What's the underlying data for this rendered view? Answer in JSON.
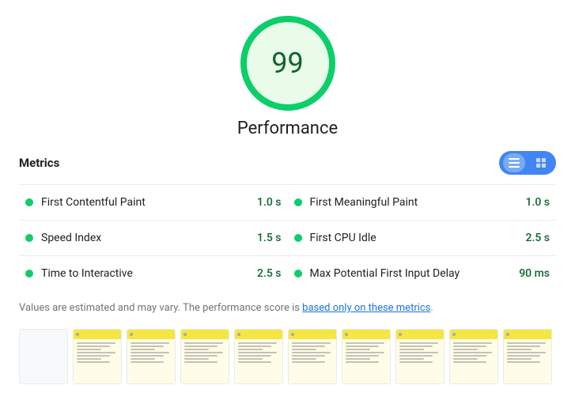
{
  "score": {
    "value": "99",
    "label": "Performance"
  },
  "metrics": {
    "title": "Metrics",
    "toggle": {
      "list_label": "List view",
      "grid_label": "Grid view"
    },
    "items": [
      {
        "name": "First Contentful Paint",
        "value": "1.0 s",
        "color": "#0cce6b"
      },
      {
        "name": "First Meaningful Paint",
        "value": "1.0 s",
        "color": "#0cce6b"
      },
      {
        "name": "Speed Index",
        "value": "1.5 s",
        "color": "#0cce6b"
      },
      {
        "name": "First CPU Idle",
        "value": "2.5 s",
        "color": "#0cce6b"
      },
      {
        "name": "Time to Interactive",
        "value": "2.5 s",
        "color": "#0cce6b"
      },
      {
        "name": "Max Potential First Input Delay",
        "value": "90 ms",
        "color": "#0cce6b"
      }
    ],
    "note_text": "Values are estimated and may vary. The performance score is ",
    "note_link": "based only on these metrics",
    "note_end": "."
  },
  "filmstrip": {
    "frames_count": 10
  }
}
